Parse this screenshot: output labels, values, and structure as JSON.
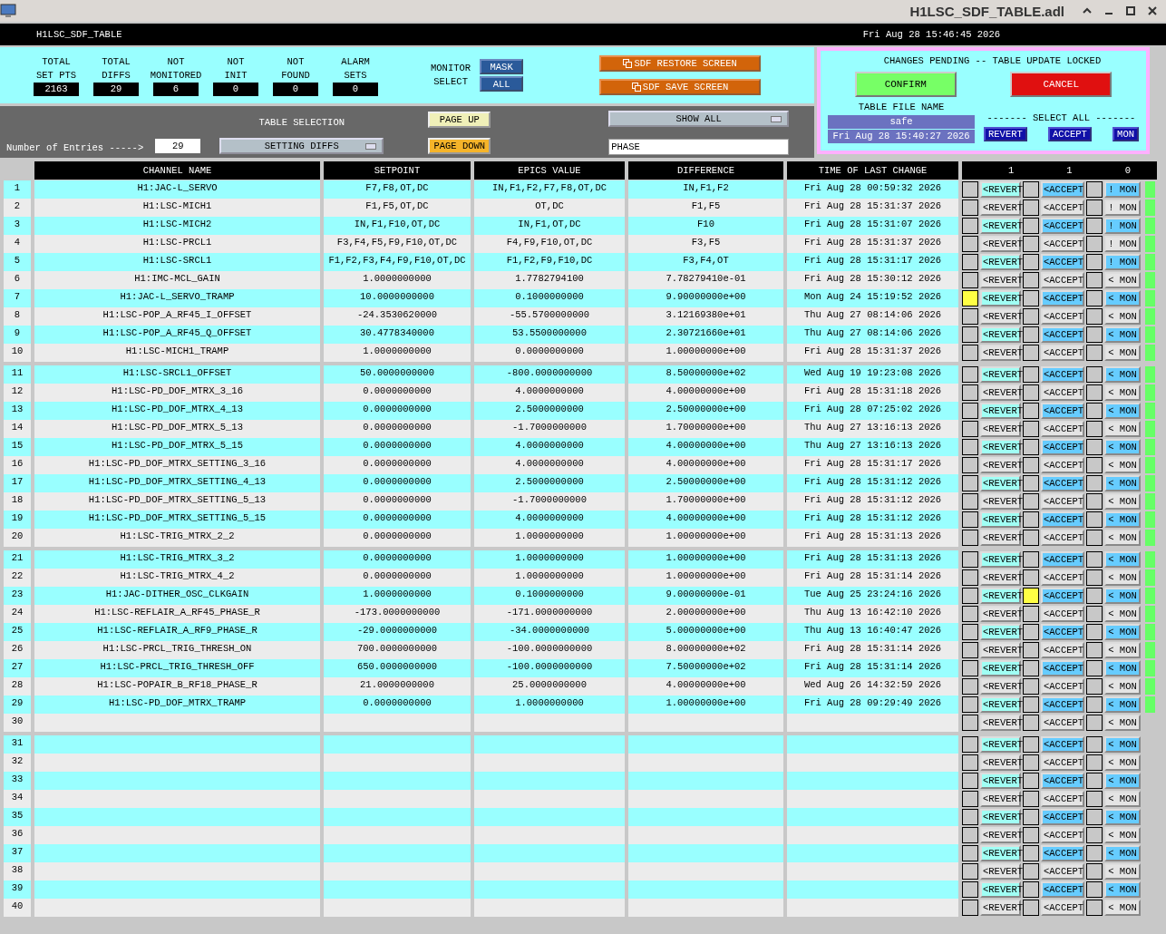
{
  "window": {
    "title": "H1LSC_SDF_TABLE.adl"
  },
  "screen": {
    "name": "H1LSC_SDF_TABLE",
    "clock": "Fri Aug 28 15:46:45 2026"
  },
  "stats": [
    {
      "label": [
        "TOTAL",
        "SET PTS"
      ],
      "value": "2163"
    },
    {
      "label": [
        "TOTAL",
        "DIFFS"
      ],
      "value": "29"
    },
    {
      "label": [
        "NOT",
        "MONITORED"
      ],
      "value": "6"
    },
    {
      "label": [
        "NOT",
        "INIT"
      ],
      "value": "0"
    },
    {
      "label": [
        "NOT",
        "FOUND"
      ],
      "value": "0"
    },
    {
      "label": [
        "ALARM",
        "SETS"
      ],
      "value": "0"
    }
  ],
  "monitor_select": {
    "label": [
      "MONITOR",
      "SELECT"
    ],
    "buttons": [
      "MASK",
      "ALL"
    ]
  },
  "screen_buttons": [
    "SDF RESTORE SCREEN",
    "SDF SAVE SCREEN"
  ],
  "entries": {
    "label": "Number of Entries ----->",
    "value": "29"
  },
  "table_selection": {
    "label": "TABLE SELECTION",
    "value": "SETTING DIFFS"
  },
  "paging": [
    {
      "label": "PAGE UP",
      "kind": "up"
    },
    {
      "label": "PAGE DOWN",
      "kind": "down"
    }
  ],
  "filter": {
    "value": "SHOW ALL"
  },
  "search": {
    "value": "PHASE"
  },
  "pending": {
    "title": "CHANGES PENDING -- TABLE UPDATE LOCKED",
    "confirm": "CONFIRM",
    "cancel": "CANCEL",
    "file_label": "TABLE FILE NAME",
    "file_name": "safe",
    "file_time": "Fri Aug 28 15:40:27 2026",
    "select_all_label": "------- SELECT ALL -------",
    "select_all_buttons": [
      "REVERT",
      "ACCEPT",
      "MON"
    ]
  },
  "table": {
    "columns": [
      "CHANNEL NAME",
      "SETPOINT",
      "EPICS VALUE",
      "DIFFERENCE",
      "TIME OF LAST CHANGE"
    ],
    "select_counts": [
      "1",
      "1",
      "0"
    ],
    "rows": [
      {
        "num": "1",
        "channel": "H1:JAC-L_SERVO",
        "setpoint": "F7,F8,OT,DC",
        "epics": "IN,F1,F2,F7,F8,OT,DC",
        "difference": "IN,F1,F2",
        "time": "Fri Aug 28 00:59:32 2026",
        "revert_checked": false,
        "revert": "<REVERT",
        "accept_checked": false,
        "accept": "<ACCEPT",
        "mon_checked": false,
        "mon": "! MON",
        "active": true
      },
      {
        "num": "2",
        "channel": "H1:LSC-MICH1",
        "setpoint": "F1,F5,OT,DC",
        "epics": "OT,DC",
        "difference": "F1,F5",
        "time": "Fri Aug 28 15:31:37 2026",
        "revert_checked": false,
        "revert": "<REVERT",
        "accept_checked": false,
        "accept": "<ACCEPT",
        "mon_checked": false,
        "mon": "! MON",
        "active": true
      },
      {
        "num": "3",
        "channel": "H1:LSC-MICH2",
        "setpoint": "IN,F1,F10,OT,DC",
        "epics": "IN,F1,OT,DC",
        "difference": "F10",
        "time": "Fri Aug 28 15:31:07 2026",
        "revert_checked": false,
        "revert": "<REVERT",
        "accept_checked": false,
        "accept": "<ACCEPT",
        "mon_checked": false,
        "mon": "! MON",
        "active": true
      },
      {
        "num": "4",
        "channel": "H1:LSC-PRCL1",
        "setpoint": "F3,F4,F5,F9,F10,OT,DC",
        "epics": "F4,F9,F10,OT,DC",
        "difference": "F3,F5",
        "time": "Fri Aug 28 15:31:37 2026",
        "revert_checked": false,
        "revert": "<REVERT",
        "accept_checked": false,
        "accept": "<ACCEPT",
        "mon_checked": false,
        "mon": "! MON",
        "active": true
      },
      {
        "num": "5",
        "channel": "H1:LSC-SRCL1",
        "setpoint": "F1,F2,F3,F4,F9,F10,OT,DC",
        "epics": "F1,F2,F9,F10,DC",
        "difference": "F3,F4,OT",
        "time": "Fri Aug 28 15:31:17 2026",
        "revert_checked": false,
        "revert": "<REVERT",
        "accept_checked": false,
        "accept": "<ACCEPT",
        "mon_checked": false,
        "mon": "! MON",
        "active": true
      },
      {
        "num": "6",
        "channel": "H1:IMC-MCL_GAIN",
        "setpoint": "1.0000000000",
        "epics": "1.7782794100",
        "difference": "7.78279410e-01",
        "time": "Fri Aug 28 15:30:12 2026",
        "revert_checked": false,
        "revert": "<REVERT",
        "accept_checked": false,
        "accept": "<ACCEPT",
        "mon_checked": false,
        "mon": "< MON",
        "active": true
      },
      {
        "num": "7",
        "channel": "H1:JAC-L_SERVO_TRAMP",
        "setpoint": "10.0000000000",
        "epics": "0.1000000000",
        "difference": "9.90000000e+00",
        "time": "Mon Aug 24 15:19:52 2026",
        "revert_checked": true,
        "revert": "<REVERT",
        "accept_checked": false,
        "accept": "<ACCEPT",
        "mon_checked": false,
        "mon": "< MON",
        "active": true
      },
      {
        "num": "8",
        "channel": "H1:LSC-POP_A_RF45_I_OFFSET",
        "setpoint": "-24.3530620000",
        "epics": "-55.5700000000",
        "difference": "3.12169380e+01",
        "time": "Thu Aug 27 08:14:06 2026",
        "revert_checked": false,
        "revert": "<REVERT",
        "accept_checked": false,
        "accept": "<ACCEPT",
        "mon_checked": false,
        "mon": "< MON",
        "active": true
      },
      {
        "num": "9",
        "channel": "H1:LSC-POP_A_RF45_Q_OFFSET",
        "setpoint": "30.4778340000",
        "epics": "53.5500000000",
        "difference": "2.30721660e+01",
        "time": "Thu Aug 27 08:14:06 2026",
        "revert_checked": false,
        "revert": "<REVERT",
        "accept_checked": false,
        "accept": "<ACCEPT",
        "mon_checked": false,
        "mon": "< MON",
        "active": true
      },
      {
        "num": "10",
        "channel": "H1:LSC-MICH1_TRAMP",
        "setpoint": "1.0000000000",
        "epics": "0.0000000000",
        "difference": "1.00000000e+00",
        "time": "Fri Aug 28 15:31:37 2026",
        "revert_checked": false,
        "revert": "<REVERT",
        "accept_checked": false,
        "accept": "<ACCEPT",
        "mon_checked": false,
        "mon": "< MON",
        "active": true
      },
      {
        "num": "11",
        "channel": "H1:LSC-SRCL1_OFFSET",
        "setpoint": "50.0000000000",
        "epics": "-800.0000000000",
        "difference": "8.50000000e+02",
        "time": "Wed Aug 19 19:23:08 2026",
        "revert_checked": false,
        "revert": "<REVERT",
        "accept_checked": false,
        "accept": "<ACCEPT",
        "mon_checked": false,
        "mon": "< MON",
        "active": true
      },
      {
        "num": "12",
        "channel": "H1:LSC-PD_DOF_MTRX_3_16",
        "setpoint": "0.0000000000",
        "epics": "4.0000000000",
        "difference": "4.00000000e+00",
        "time": "Fri Aug 28 15:31:18 2026",
        "revert_checked": false,
        "revert": "<REVERT",
        "accept_checked": false,
        "accept": "<ACCEPT",
        "mon_checked": false,
        "mon": "< MON",
        "active": true
      },
      {
        "num": "13",
        "channel": "H1:LSC-PD_DOF_MTRX_4_13",
        "setpoint": "0.0000000000",
        "epics": "2.5000000000",
        "difference": "2.50000000e+00",
        "time": "Fri Aug 28 07:25:02 2026",
        "revert_checked": false,
        "revert": "<REVERT",
        "accept_checked": false,
        "accept": "<ACCEPT",
        "mon_checked": false,
        "mon": "< MON",
        "active": true
      },
      {
        "num": "14",
        "channel": "H1:LSC-PD_DOF_MTRX_5_13",
        "setpoint": "0.0000000000",
        "epics": "-1.7000000000",
        "difference": "1.70000000e+00",
        "time": "Thu Aug 27 13:16:13 2026",
        "revert_checked": false,
        "revert": "<REVERT",
        "accept_checked": false,
        "accept": "<ACCEPT",
        "mon_checked": false,
        "mon": "< MON",
        "active": true
      },
      {
        "num": "15",
        "channel": "H1:LSC-PD_DOF_MTRX_5_15",
        "setpoint": "0.0000000000",
        "epics": "4.0000000000",
        "difference": "4.00000000e+00",
        "time": "Thu Aug 27 13:16:13 2026",
        "revert_checked": false,
        "revert": "<REVERT",
        "accept_checked": false,
        "accept": "<ACCEPT",
        "mon_checked": false,
        "mon": "< MON",
        "active": true
      },
      {
        "num": "16",
        "channel": "H1:LSC-PD_DOF_MTRX_SETTING_3_16",
        "setpoint": "0.0000000000",
        "epics": "4.0000000000",
        "difference": "4.00000000e+00",
        "time": "Fri Aug 28 15:31:17 2026",
        "revert_checked": false,
        "revert": "<REVERT",
        "accept_checked": false,
        "accept": "<ACCEPT",
        "mon_checked": false,
        "mon": "< MON",
        "active": true
      },
      {
        "num": "17",
        "channel": "H1:LSC-PD_DOF_MTRX_SETTING_4_13",
        "setpoint": "0.0000000000",
        "epics": "2.5000000000",
        "difference": "2.50000000e+00",
        "time": "Fri Aug 28 15:31:12 2026",
        "revert_checked": false,
        "revert": "<REVERT",
        "accept_checked": false,
        "accept": "<ACCEPT",
        "mon_checked": false,
        "mon": "< MON",
        "active": true
      },
      {
        "num": "18",
        "channel": "H1:LSC-PD_DOF_MTRX_SETTING_5_13",
        "setpoint": "0.0000000000",
        "epics": "-1.7000000000",
        "difference": "1.70000000e+00",
        "time": "Fri Aug 28 15:31:12 2026",
        "revert_checked": false,
        "revert": "<REVERT",
        "accept_checked": false,
        "accept": "<ACCEPT",
        "mon_checked": false,
        "mon": "< MON",
        "active": true
      },
      {
        "num": "19",
        "channel": "H1:LSC-PD_DOF_MTRX_SETTING_5_15",
        "setpoint": "0.0000000000",
        "epics": "4.0000000000",
        "difference": "4.00000000e+00",
        "time": "Fri Aug 28 15:31:12 2026",
        "revert_checked": false,
        "revert": "<REVERT",
        "accept_checked": false,
        "accept": "<ACCEPT",
        "mon_checked": false,
        "mon": "< MON",
        "active": true
      },
      {
        "num": "20",
        "channel": "H1:LSC-TRIG_MTRX_2_2",
        "setpoint": "0.0000000000",
        "epics": "1.0000000000",
        "difference": "1.00000000e+00",
        "time": "Fri Aug 28 15:31:13 2026",
        "revert_checked": false,
        "revert": "<REVERT",
        "accept_checked": false,
        "accept": "<ACCEPT",
        "mon_checked": false,
        "mon": "< MON",
        "active": true
      },
      {
        "num": "21",
        "channel": "H1:LSC-TRIG_MTRX_3_2",
        "setpoint": "0.0000000000",
        "epics": "1.0000000000",
        "difference": "1.00000000e+00",
        "time": "Fri Aug 28 15:31:13 2026",
        "revert_checked": false,
        "revert": "<REVERT",
        "accept_checked": false,
        "accept": "<ACCEPT",
        "mon_checked": false,
        "mon": "< MON",
        "active": true
      },
      {
        "num": "22",
        "channel": "H1:LSC-TRIG_MTRX_4_2",
        "setpoint": "0.0000000000",
        "epics": "1.0000000000",
        "difference": "1.00000000e+00",
        "time": "Fri Aug 28 15:31:14 2026",
        "revert_checked": false,
        "revert": "<REVERT",
        "accept_checked": false,
        "accept": "<ACCEPT",
        "mon_checked": false,
        "mon": "< MON",
        "active": true
      },
      {
        "num": "23",
        "channel": "H1:JAC-DITHER_OSC_CLKGAIN",
        "setpoint": "1.0000000000",
        "epics": "0.1000000000",
        "difference": "9.00000000e-01",
        "time": "Tue Aug 25 23:24:16 2026",
        "revert_checked": false,
        "revert": "<REVERT",
        "accept_checked": true,
        "accept": "<ACCEPT",
        "mon_checked": false,
        "mon": "< MON",
        "active": true
      },
      {
        "num": "24",
        "channel": "H1:LSC-REFLAIR_A_RF45_PHASE_R",
        "setpoint": "-173.0000000000",
        "epics": "-171.0000000000",
        "difference": "2.00000000e+00",
        "time": "Thu Aug 13 16:42:10 2026",
        "revert_checked": false,
        "revert": "<REVERT",
        "accept_checked": false,
        "accept": "<ACCEPT",
        "mon_checked": false,
        "mon": "< MON",
        "active": true
      },
      {
        "num": "25",
        "channel": "H1:LSC-REFLAIR_A_RF9_PHASE_R",
        "setpoint": "-29.0000000000",
        "epics": "-34.0000000000",
        "difference": "5.00000000e+00",
        "time": "Thu Aug 13 16:40:47 2026",
        "revert_checked": false,
        "revert": "<REVERT",
        "accept_checked": false,
        "accept": "<ACCEPT",
        "mon_checked": false,
        "mon": "< MON",
        "active": true
      },
      {
        "num": "26",
        "channel": "H1:LSC-PRCL_TRIG_THRESH_ON",
        "setpoint": "700.0000000000",
        "epics": "-100.0000000000",
        "difference": "8.00000000e+02",
        "time": "Fri Aug 28 15:31:14 2026",
        "revert_checked": false,
        "revert": "<REVERT",
        "accept_checked": false,
        "accept": "<ACCEPT",
        "mon_checked": false,
        "mon": "< MON",
        "active": true
      },
      {
        "num": "27",
        "channel": "H1:LSC-PRCL_TRIG_THRESH_OFF",
        "setpoint": "650.0000000000",
        "epics": "-100.0000000000",
        "difference": "7.50000000e+02",
        "time": "Fri Aug 28 15:31:14 2026",
        "revert_checked": false,
        "revert": "<REVERT",
        "accept_checked": false,
        "accept": "<ACCEPT",
        "mon_checked": false,
        "mon": "< MON",
        "active": true
      },
      {
        "num": "28",
        "channel": "H1:LSC-POPAIR_B_RF18_PHASE_R",
        "setpoint": "21.0000000000",
        "epics": "25.0000000000",
        "difference": "4.00000000e+00",
        "time": "Wed Aug 26 14:32:59 2026",
        "revert_checked": false,
        "revert": "<REVERT",
        "accept_checked": false,
        "accept": "<ACCEPT",
        "mon_checked": false,
        "mon": "< MON",
        "active": true
      },
      {
        "num": "29",
        "channel": "H1:LSC-PD_DOF_MTRX_TRAMP",
        "setpoint": "0.0000000000",
        "epics": "1.0000000000",
        "difference": "1.00000000e+00",
        "time": "Fri Aug 28 09:29:49 2026",
        "revert_checked": false,
        "revert": "<REVERT",
        "accept_checked": false,
        "accept": "<ACCEPT",
        "mon_checked": false,
        "mon": "< MON",
        "active": true
      },
      {
        "num": "30",
        "revert_checked": false,
        "revert": "<REVERT",
        "accept_checked": false,
        "accept": "<ACCEPT",
        "mon_checked": false,
        "mon": "< MON",
        "active": false
      },
      {
        "num": "31",
        "revert_checked": false,
        "revert": "<REVERT",
        "accept_checked": false,
        "accept": "<ACCEPT",
        "mon_checked": false,
        "mon": "< MON",
        "active": false
      },
      {
        "num": "32",
        "revert_checked": false,
        "revert": "<REVERT",
        "accept_checked": false,
        "accept": "<ACCEPT",
        "mon_checked": false,
        "mon": "< MON",
        "active": false
      },
      {
        "num": "33",
        "revert_checked": false,
        "revert": "<REVERT",
        "accept_checked": false,
        "accept": "<ACCEPT",
        "mon_checked": false,
        "mon": "< MON",
        "active": false
      },
      {
        "num": "34",
        "revert_checked": false,
        "revert": "<REVERT",
        "accept_checked": false,
        "accept": "<ACCEPT",
        "mon_checked": false,
        "mon": "< MON",
        "active": false
      },
      {
        "num": "35",
        "revert_checked": false,
        "revert": "<REVERT",
        "accept_checked": false,
        "accept": "<ACCEPT",
        "mon_checked": false,
        "mon": "< MON",
        "active": false
      },
      {
        "num": "36",
        "revert_checked": false,
        "revert": "<REVERT",
        "accept_checked": false,
        "accept": "<ACCEPT",
        "mon_checked": false,
        "mon": "< MON",
        "active": false
      },
      {
        "num": "37",
        "revert_checked": false,
        "revert": "<REVERT",
        "accept_checked": false,
        "accept": "<ACCEPT",
        "mon_checked": false,
        "mon": "< MON",
        "active": false
      },
      {
        "num": "38",
        "revert_checked": false,
        "revert": "<REVERT",
        "accept_checked": false,
        "accept": "<ACCEPT",
        "mon_checked": false,
        "mon": "< MON",
        "active": false
      },
      {
        "num": "39",
        "revert_checked": false,
        "revert": "<REVERT",
        "accept_checked": false,
        "accept": "<ACCEPT",
        "mon_checked": false,
        "mon": "< MON",
        "active": false
      },
      {
        "num": "40",
        "revert_checked": false,
        "revert": "<REVERT",
        "accept_checked": false,
        "accept": "<ACCEPT",
        "mon_checked": false,
        "mon": "< MON",
        "active": false
      }
    ]
  }
}
